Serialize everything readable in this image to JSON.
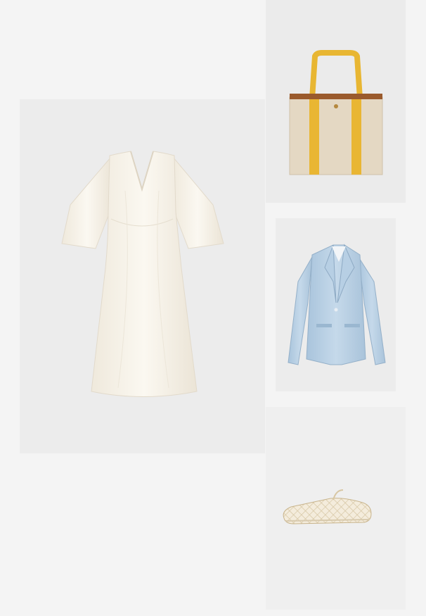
{
  "products": [
    {
      "key": "dress",
      "icon": "white-dress-image",
      "color": "#f6f1e6"
    },
    {
      "key": "bag",
      "icon": "tote-bag-image",
      "color": "#ead9b9"
    },
    {
      "key": "blazer",
      "icon": "blue-blazer-image",
      "color": "#bcd3e6"
    },
    {
      "key": "shoe",
      "icon": "mesh-flat-shoe-image",
      "color": "#efe6d2"
    }
  ]
}
